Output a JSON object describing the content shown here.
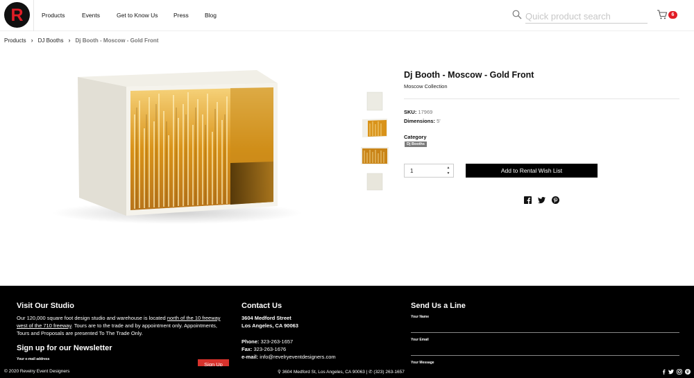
{
  "header": {
    "logo_letter": "R",
    "nav": [
      "Products",
      "Events",
      "Get to Know Us",
      "Press",
      "Blog"
    ],
    "search_placeholder": "Quick product search",
    "cart_count": "6"
  },
  "breadcrumb": [
    "Products",
    "DJ Booths",
    "Dj Booth - Moscow - Gold Front"
  ],
  "product": {
    "title": "Dj Booth - Moscow - Gold Front",
    "collection": "Moscow Collection",
    "sku_label": "SKU:",
    "sku": "17969",
    "dimensions_label": "Dimensions:",
    "dimensions": "5'",
    "category_label": "Category",
    "category": "Dj Booths",
    "quantity": "1",
    "wish_button": "Add to Rental Wish List"
  },
  "footer": {
    "studio_heading": "Visit Our Studio",
    "studio_text_1": "Our 120,000 square foot design studio and warehouse is located ",
    "studio_link": "north of the 10 freeway west of the 710 freeway",
    "studio_text_2": ". Tours are to the trade and by appointment only. Appointments, Tours and Proposals are presented To The Trade Only.",
    "newsletter_heading": "Sign up for our Newsletter",
    "email_label": "Your e-mail address",
    "signup_button": "Sign Up",
    "contact_heading": "Contact Us",
    "address_line1": "3604 Medford Street",
    "address_line2": "Los Angeles, CA 90063",
    "phone_label": "Phone:",
    "phone": "323-263-1657",
    "fax_label": "Fax:",
    "fax": "323-263-1676",
    "email_contact_label": "e-mail:",
    "email": "info@revelryeventdesigners.com",
    "line_heading": "Send Us a Line",
    "name_label": "Your Name",
    "your_email_label": "Your Email",
    "message_label": "Your Message",
    "copyright": "© 2020 Revelry Event Designers",
    "bottom_address": "3604 Medford St, Los Angeles, CA 90063 | ",
    "bottom_phone": "(323) 263-1657"
  },
  "colors": {
    "brand_red": "#e11d26",
    "footer_bg": "#000000",
    "button_bg": "#000000",
    "gold": "#d99a1e"
  }
}
